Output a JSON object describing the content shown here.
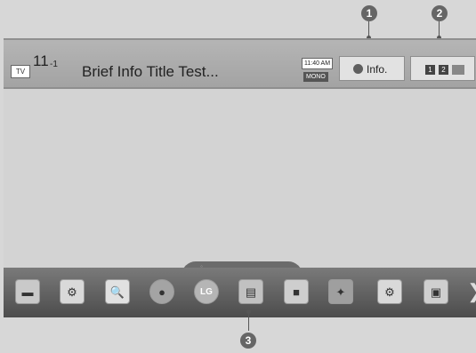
{
  "status_bar": {
    "input_label": "TV",
    "channel_major": "11",
    "channel_minor": "-1",
    "title": "Brief Info Title Test...",
    "time": "11:40 AM",
    "audio": "MONO",
    "info_label": "Info.",
    "layout_1": "1",
    "layout_2": "2"
  },
  "callouts": [
    "1",
    "2",
    "3"
  ],
  "dock": {
    "apps": [
      {
        "icon": "input-list-icon",
        "glyph": "▬"
      },
      {
        "icon": "settings-icon",
        "glyph": "⚙"
      },
      {
        "icon": "search-icon",
        "glyph": "🔍"
      },
      {
        "icon": "web-browser-icon",
        "glyph": "●"
      },
      {
        "icon": "lg-logo-icon",
        "glyph": "LG"
      },
      {
        "icon": "guide-icon",
        "glyph": "▤"
      },
      {
        "icon": "cube-icon",
        "glyph": "■"
      },
      {
        "icon": "app-cluster-icon",
        "glyph": "✦"
      },
      {
        "icon": "settings-check-icon",
        "glyph": "⚙"
      },
      {
        "icon": "window-icon",
        "glyph": "▣"
      }
    ],
    "next_glyph": "❯"
  }
}
